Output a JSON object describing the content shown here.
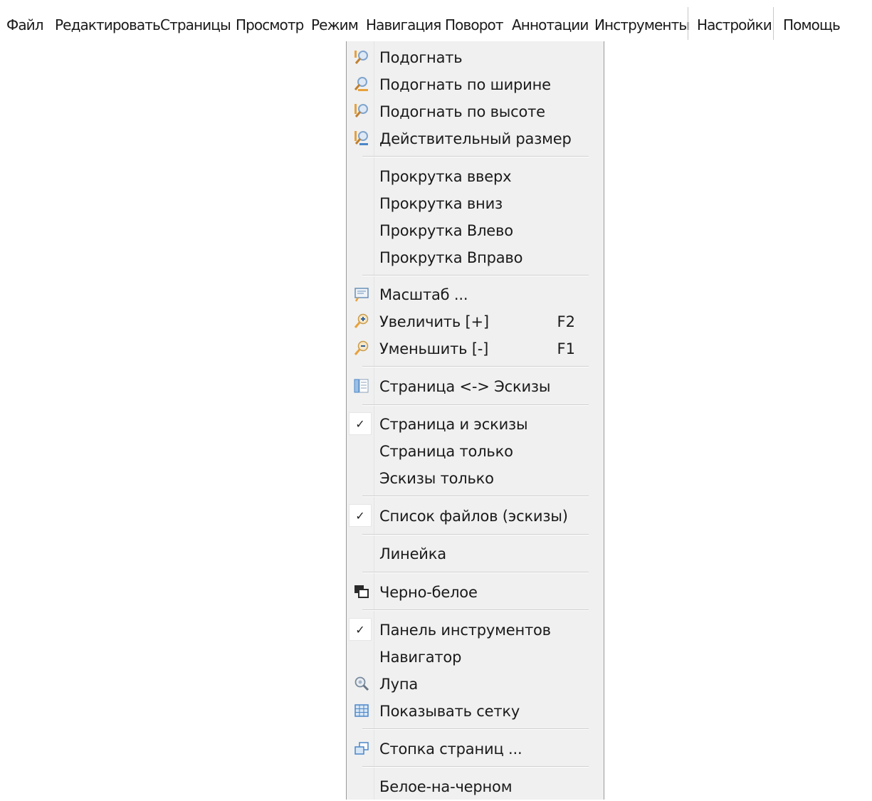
{
  "menubar": {
    "items": [
      "Файл",
      "Редактировать",
      "Страницы",
      "Просмотр",
      "Режим",
      "Навигация",
      "Поворот",
      "Аннотации",
      "Инструменты",
      "Настройки",
      "Помощь"
    ]
  },
  "menu": {
    "fit": "Подогнать",
    "fit_width": "Подогнать по ширине",
    "fit_height": "Подогнать по высоте",
    "actual_size": "Действительный размер",
    "scroll_up": "Прокрутка вверх",
    "scroll_down": "Прокрутка вниз",
    "scroll_left": "Прокрутка Влево",
    "scroll_right": "Прокрутка Вправо",
    "zoom": "Масштаб ...",
    "zoom_in": "Увеличить [+]",
    "zoom_in_shortcut": "F2",
    "zoom_out": "Уменьшить [-]",
    "zoom_out_shortcut": "F1",
    "page_thumbs_toggle": "Страница <-> Эскизы",
    "page_and_thumbs": "Страница и эскизы",
    "page_only": "Страница только",
    "thumbs_only": "Эскизы только",
    "file_list": "Список файлов (эскизы)",
    "ruler": "Линейка",
    "black_white": "Черно-белое",
    "toolbar": "Панель инструментов",
    "navigator": "Навигатор",
    "magnifier": "Лупа",
    "show_grid": "Показывать сетку",
    "page_stack": "Стопка страниц ...",
    "white_on_black": "Белое-на-черном"
  },
  "checked": {
    "page_and_thumbs": true,
    "file_list": true,
    "toolbar": true
  },
  "check_glyph": "✓",
  "icons": {
    "fit": "fit-icon",
    "fit_width": "fit-width-icon",
    "fit_height": "fit-height-icon",
    "actual_size": "actual-size-icon",
    "zoom": "zoom-dialog-icon",
    "zoom_in": "zoom-in-icon",
    "zoom_out": "zoom-out-icon",
    "page_thumbs_toggle": "page-thumbs-icon",
    "black_white": "black-white-icon",
    "magnifier": "magnifier-icon",
    "show_grid": "grid-icon",
    "page_stack": "page-stack-icon"
  },
  "colors": {
    "menu_background": "#f0f0f0",
    "icon_orange": "#e8a13a",
    "icon_blue": "#4a86c8"
  }
}
